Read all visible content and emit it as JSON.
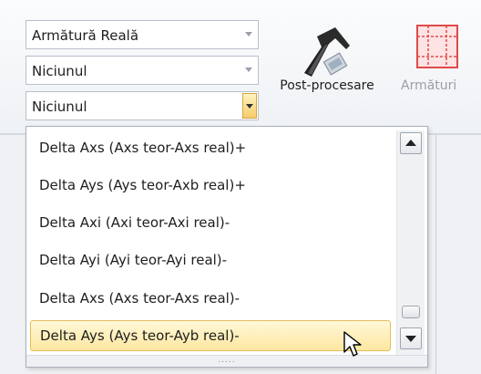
{
  "combos": {
    "combo1_value": "Armătură Reală",
    "combo2_value": "Niciunul",
    "combo3_value": "Niciunul"
  },
  "ribbon": {
    "postprocess_label": "Post-procesare",
    "rebars_label": "Armături"
  },
  "dropdown": {
    "items": [
      "Delta Axs (Axs teor-Axs real)+",
      "Delta Ays (Ays teor-Axb real)+",
      "Delta Axi (Axi teor-Axi real)-",
      "Delta Ayi (Ayi teor-Ayi real)-",
      "Delta Axs (Axs teor-Axs real)-",
      "Delta Ays (Ays teor-Ayb real)-"
    ],
    "selected_index": 5,
    "grip": "....."
  },
  "icons": {
    "postprocess": "hammer-icon",
    "rebars": "rebar-grid-icon",
    "scroll_up": "scroll-up-icon",
    "scroll_down": "scroll-down-icon",
    "cursor": "mouse-pointer-icon"
  },
  "colors": {
    "selection_fill": "#fde7a0",
    "selection_border": "#e2be5a",
    "rebar_icon": "#e04a4a"
  }
}
